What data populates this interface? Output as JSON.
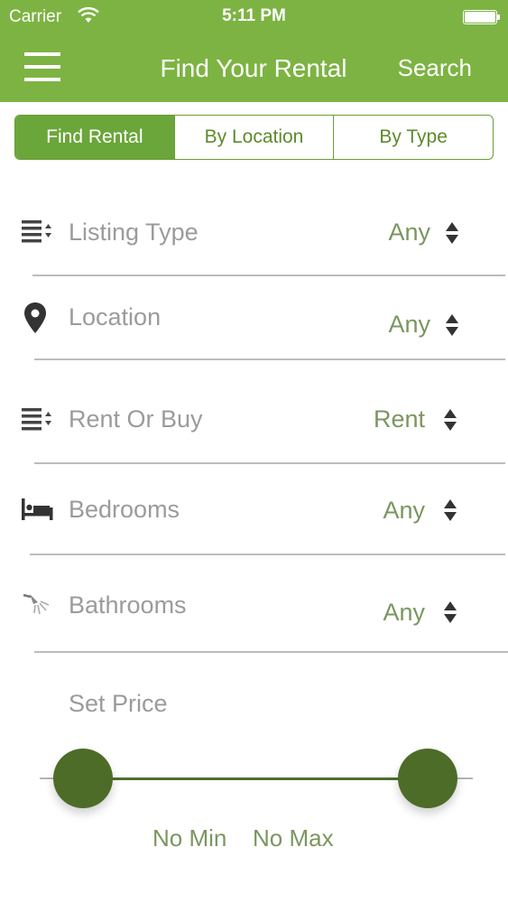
{
  "status_bar": {
    "carrier": "Carrier",
    "time": "5:11 PM"
  },
  "nav": {
    "title": "Find Your Rental",
    "search_label": "Search"
  },
  "segments": [
    {
      "label": "Find Rental",
      "active": true
    },
    {
      "label": "By Location",
      "active": false
    },
    {
      "label": "By Type",
      "active": false
    }
  ],
  "filters": {
    "listing_type": {
      "label": "Listing Type",
      "value": "Any",
      "icon": "list-sort-icon"
    },
    "location": {
      "label": "Location",
      "value": "Any",
      "icon": "map-pin-icon"
    },
    "rent_or_buy": {
      "label": "Rent Or Buy",
      "value": "Rent",
      "icon": "list-sort-icon"
    },
    "bedrooms": {
      "label": "Bedrooms",
      "value": "Any",
      "icon": "bed-icon"
    },
    "bathrooms": {
      "label": "Bathrooms",
      "value": "Any",
      "icon": "shower-icon"
    }
  },
  "price": {
    "label": "Set Price",
    "min_label": "No Min",
    "max_label": "No Max"
  },
  "colors": {
    "accent": "#7db343",
    "dark_green": "#4d6c28",
    "label_gray": "#9b9b9b",
    "value_green": "#7b9660"
  }
}
